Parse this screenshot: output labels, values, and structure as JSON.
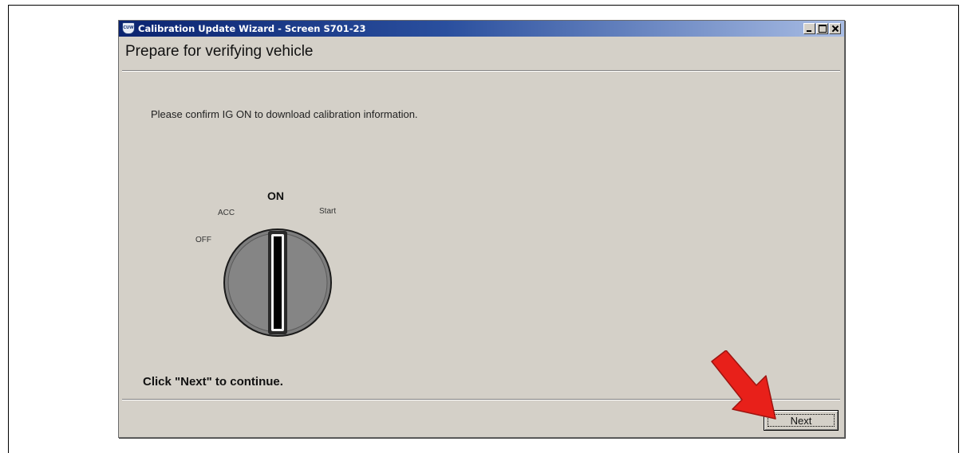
{
  "window": {
    "title": "Calibration Update Wizard - Screen S701-23",
    "app_icon_text": "CUW"
  },
  "page": {
    "heading": "Prepare for verifying vehicle",
    "instruction": "Please confirm IG ON to download calibration information.",
    "continue_prompt": "Click \"Next\" to continue."
  },
  "ignition": {
    "positions": [
      "OFF",
      "ACC",
      "ON",
      "Start"
    ],
    "selected": "ON",
    "icon": "ignition-key-cylinder"
  },
  "buttons": {
    "next_label": "Next"
  },
  "callout": {
    "icon": "red-arrow",
    "color": "#e8201a",
    "points_to": "Next"
  },
  "colors": {
    "titlebar_start": "#0b2470",
    "titlebar_end": "#a9bde4",
    "window_bg": "#d4d0c8"
  }
}
